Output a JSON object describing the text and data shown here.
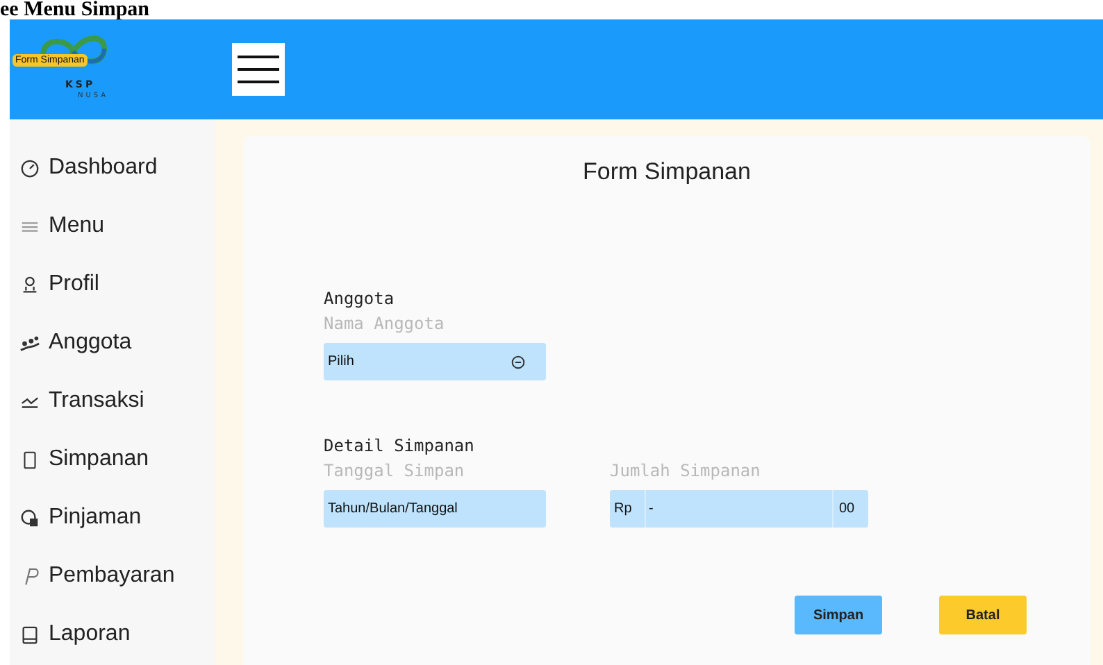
{
  "caption": "ee Menu Simpan",
  "header": {
    "logo": {
      "badge": "Form Simpanan",
      "name": "KSP",
      "subname": "NUSA"
    }
  },
  "sidebar": {
    "items": [
      {
        "label": "Dashboard"
      },
      {
        "label": "Menu"
      },
      {
        "label": "Profil"
      },
      {
        "label": "Anggota"
      },
      {
        "label": "Transaksi"
      },
      {
        "label": "Simpanan"
      },
      {
        "label": "Pinjaman"
      },
      {
        "label": "Pembayaran"
      },
      {
        "label": "Laporan"
      }
    ]
  },
  "form": {
    "title": "Form Simpanan",
    "sections": [
      {
        "heading": "Anggota",
        "fields": [
          {
            "kind": "select",
            "label": "Nama Anggota",
            "value": "Pilih"
          }
        ]
      },
      {
        "heading": "Detail Simpanan",
        "fields": [
          {
            "kind": "date",
            "label": "Tanggal Simpan",
            "placeholder": "Tahun/Bulan/Tanggal"
          },
          {
            "kind": "currency",
            "label": "Jumlah Simpanan",
            "prefix": "Rp",
            "value": "-",
            "suffix": "00"
          }
        ]
      }
    ],
    "buttons": [
      {
        "label": "Simpan",
        "kind": "primary"
      },
      {
        "label": "Batal",
        "kind": "cancel"
      }
    ]
  }
}
